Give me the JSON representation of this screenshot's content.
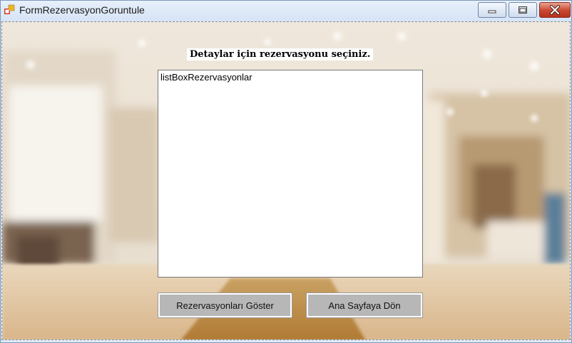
{
  "window": {
    "title": "FormRezervasyonGoruntule",
    "controls": {
      "minimize": "minimize-icon",
      "maximize": "maximize-icon",
      "close": "close-icon"
    }
  },
  "form": {
    "heading": "Detaylar için rezervasyonu seçiniz.",
    "listbox": {
      "items": [
        "listBoxRezervasyonlar"
      ]
    },
    "buttons": {
      "show_reservations": "Rezervasyonları  Göster",
      "back_home": "Ana Sayfaya Dön"
    }
  }
}
